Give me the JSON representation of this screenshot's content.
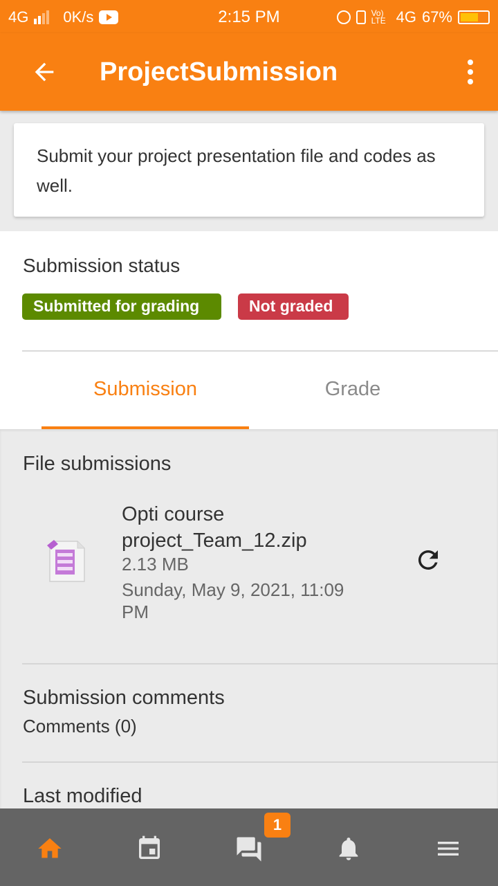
{
  "status_bar": {
    "network_left": "4G",
    "speed": "0K/s",
    "time": "2:15 PM",
    "volte": "Vo) LTE",
    "network_right": "4G",
    "battery_percent": "67%",
    "battery_level": 0.67
  },
  "app_bar": {
    "title": "ProjectSubmission",
    "back_icon": "arrow-back-icon",
    "menu_icon": "more-vertical-icon"
  },
  "intro": {
    "text": "Submit your project presentation file and codes as well."
  },
  "submission_status": {
    "label": "Submission status",
    "badges": [
      {
        "label": "Submitted for grading",
        "color": "#5c8a00"
      },
      {
        "label": "Not graded",
        "color": "#ca3a47"
      }
    ]
  },
  "tabs": [
    {
      "label": "Submission",
      "active": true
    },
    {
      "label": "Grade",
      "active": false
    }
  ],
  "file_submissions": {
    "heading": "File submissions",
    "file": {
      "name": "Opti course project_Team_12.zip",
      "size": "2.13 MB",
      "date": "Sunday, May 9, 2021, 11:09 PM",
      "icon": "archive-file-icon"
    }
  },
  "comments": {
    "heading": "Submission comments",
    "link": "Comments (0)"
  },
  "last_modified": {
    "heading": "Last modified"
  },
  "bottom_nav": {
    "items": [
      {
        "icon": "home-icon",
        "active": true
      },
      {
        "icon": "calendar-icon",
        "active": false
      },
      {
        "icon": "messages-icon",
        "active": false,
        "badge": "1"
      },
      {
        "icon": "bell-icon",
        "active": false
      },
      {
        "icon": "menu-icon",
        "active": false
      }
    ]
  },
  "colors": {
    "primary": "#f98012",
    "success": "#5c8a00",
    "danger": "#ca3a47",
    "nav_bg": "#646464"
  }
}
